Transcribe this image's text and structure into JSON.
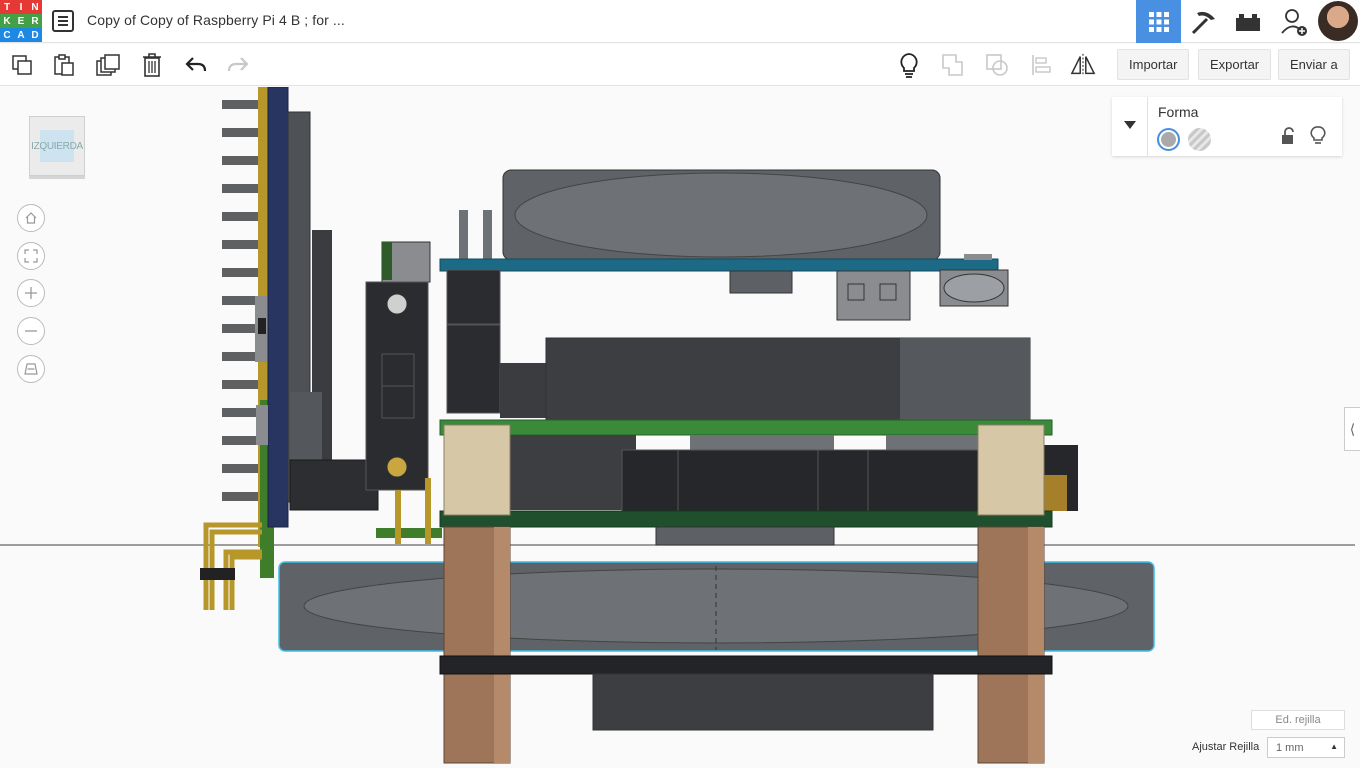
{
  "header": {
    "logo_letters": [
      "T",
      "I",
      "N",
      "K",
      "E",
      "R",
      "C",
      "A",
      "D"
    ],
    "logo_colors": [
      "#e53935",
      "#e53935",
      "#e53935",
      "#43a047",
      "#43a047",
      "#43a047",
      "#1e88e5",
      "#1e88e5",
      "#1e88e5"
    ],
    "document_title": "Copy of Copy of Raspberry Pi 4 B ; for ...",
    "modes": [
      "grid-3d-view-icon",
      "pickaxe-icon",
      "bricks-icon",
      "add-user-icon"
    ],
    "accent": "#4a90e2"
  },
  "toolbar": {
    "import_label": "Importar",
    "export_label": "Exportar",
    "send_label": "Enviar a"
  },
  "viewcube": {
    "face_label": "IZQUIERDA"
  },
  "shape_panel": {
    "title": "Forma",
    "solid_color": "#a9a9a9",
    "hole_color": "#c8c8c8"
  },
  "footer": {
    "edit_grid_label": "Ed. rejilla",
    "snap_grid_label": "Ajustar Rejilla",
    "snap_grid_value": "1 mm"
  }
}
